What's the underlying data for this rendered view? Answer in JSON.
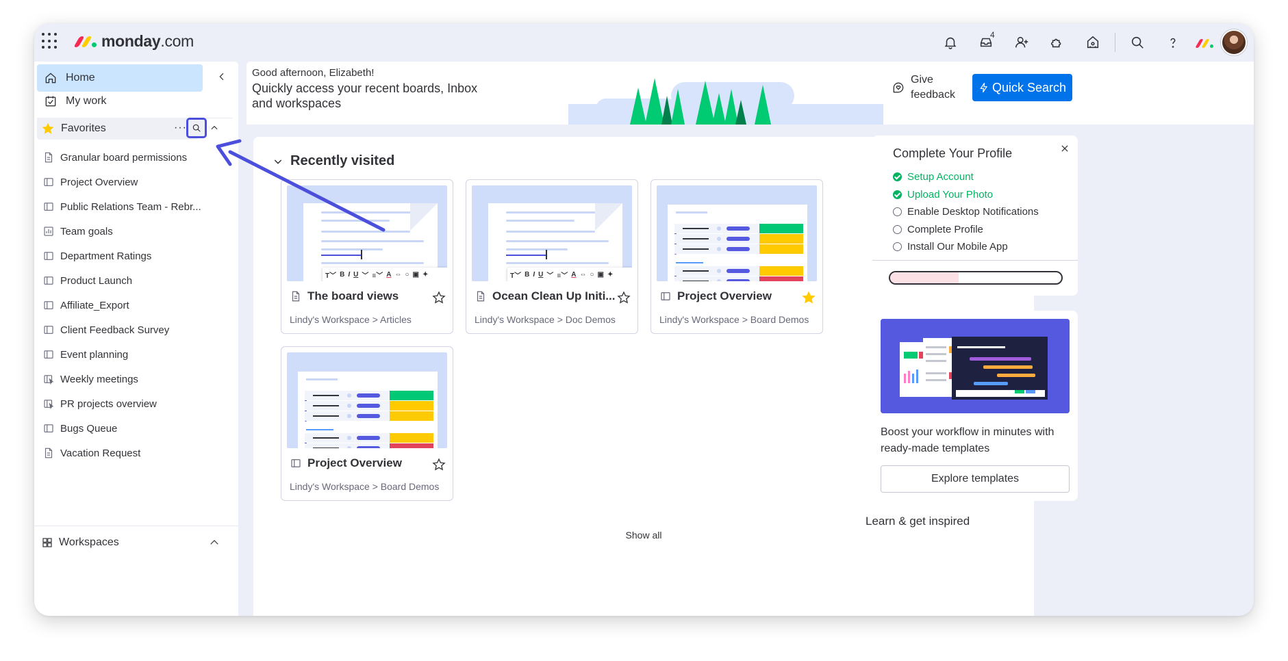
{
  "brand": {
    "name_bold": "monday",
    "name_suffix": ".com"
  },
  "topbar": {
    "icons": [
      "bell-icon",
      "inbox-icon",
      "invite-user-icon",
      "apps-puzzle-icon",
      "integrations-icon",
      "search-icon",
      "help-icon"
    ],
    "inbox_count": "4"
  },
  "sidebar": {
    "home_label": "Home",
    "mywork_label": "My work",
    "favorites_label": "Favorites",
    "favorites_more": "···",
    "favorites": [
      {
        "label": "Granular board permissions",
        "icon": "doc-icon"
      },
      {
        "label": "Project Overview",
        "icon": "board-icon"
      },
      {
        "label": "Public Relations Team - Rebr...",
        "icon": "board-icon"
      },
      {
        "label": "Team goals",
        "icon": "dashboard-icon"
      },
      {
        "label": "Department Ratings",
        "icon": "board-icon"
      },
      {
        "label": "Product Launch",
        "icon": "board-icon"
      },
      {
        "label": "Affiliate_Export",
        "icon": "board-icon"
      },
      {
        "label": "Client Feedback Survey",
        "icon": "board-icon"
      },
      {
        "label": "Event planning",
        "icon": "board-icon"
      },
      {
        "label": "Weekly meetings",
        "icon": "shared-board-icon"
      },
      {
        "label": "PR projects overview",
        "icon": "shared-board-icon"
      },
      {
        "label": "Bugs Queue",
        "icon": "board-icon"
      },
      {
        "label": "Vacation Request",
        "icon": "doc-icon"
      }
    ],
    "workspaces_label": "Workspaces"
  },
  "banner": {
    "greeting": "Good afternoon, Elizabeth!",
    "subtitle": "Quickly access your recent boards, Inbox and workspaces",
    "feedback_label": "Give feedback",
    "quick_search_label": "Quick Search"
  },
  "recent": {
    "heading": "Recently visited",
    "show_all": "Show all",
    "cards": [
      {
        "title": "The board views",
        "path": "Lindy's Workspace > Articles",
        "kind": "doc",
        "starred": false
      },
      {
        "title": "Ocean Clean Up Initi...",
        "path": "Lindy's Workspace > Doc Demos",
        "kind": "doc",
        "starred": false
      },
      {
        "title": "Project Overview",
        "path": "Lindy's Workspace > Board Demos",
        "kind": "board",
        "starred": true
      },
      {
        "title": "Project Overview",
        "path": "Lindy's Workspace > Board Demos",
        "kind": "board",
        "starred": false
      }
    ]
  },
  "profile": {
    "title": "Complete Your Profile",
    "items": [
      {
        "label": "Setup Account",
        "done": true
      },
      {
        "label": "Upload Your Photo",
        "done": true
      },
      {
        "label": "Enable Desktop Notifications",
        "done": false
      },
      {
        "label": "Complete Profile",
        "done": false
      },
      {
        "label": "Install Our Mobile App",
        "done": false
      }
    ],
    "progress": 0.4
  },
  "templates": {
    "text": "Boost your workflow in minutes with ready-made templates",
    "button_label": "Explore templates"
  },
  "learn_heading": "Learn & get inspired",
  "colors": {
    "primary": "#0073ea",
    "active_nav": "#cce5ff",
    "done_green": "#00b461",
    "highlight": "#4b4fdc",
    "star": "#ffcb00"
  }
}
